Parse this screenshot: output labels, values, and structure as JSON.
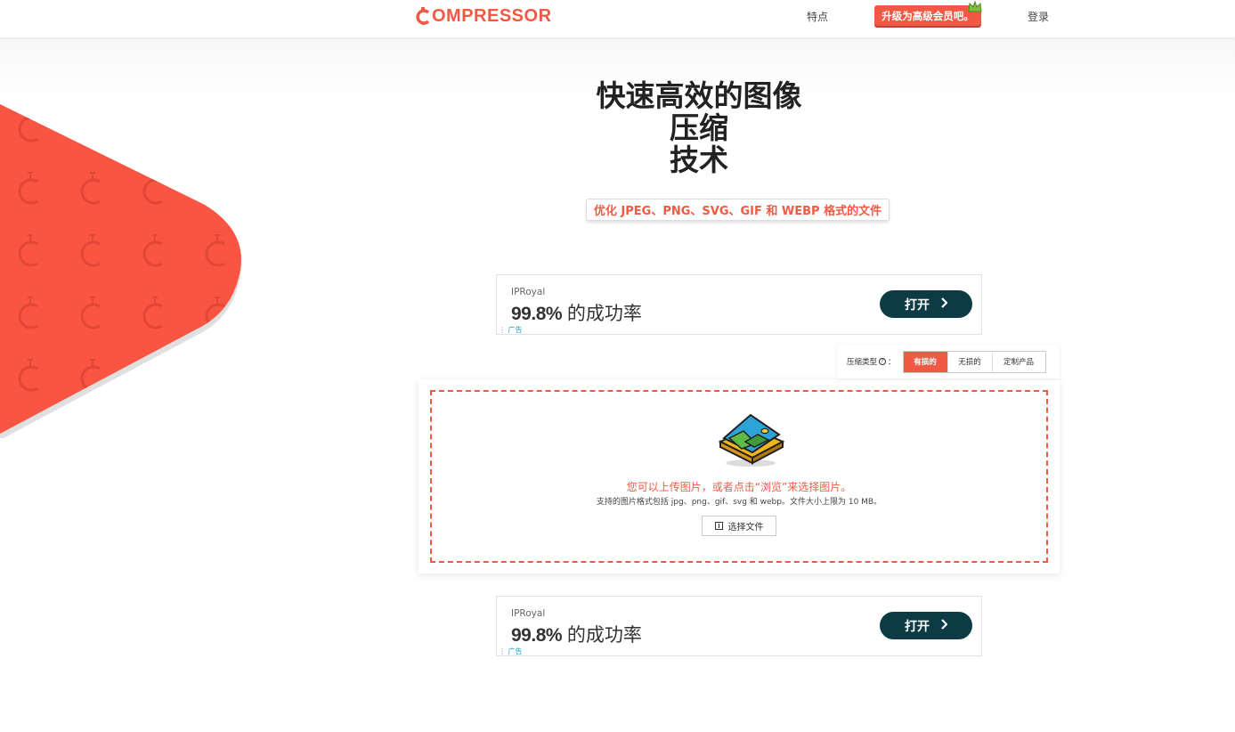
{
  "header": {
    "logo_text": "OMPRESSOR",
    "logo_initial": "C",
    "nav_features": "特点",
    "upgrade_label": "升级为高级会员吧。",
    "nav_login": "登录"
  },
  "hero": {
    "title_lines": [
      "快速高效的图像",
      "压缩",
      "技术"
    ],
    "formats": "优化 JPEG、PNG、SVG、GIF 和 WEBP 格式的文件"
  },
  "ads": [
    {
      "brand": "IPRoyal",
      "headline_number": "99.8%",
      "headline_text": " 的成功率",
      "tag": "广告",
      "button": "打开"
    },
    {
      "brand": "IPRoyal",
      "headline_number": "99.8%",
      "headline_text": " 的成功率",
      "tag": "广告",
      "button": "打开"
    }
  ],
  "compression": {
    "label": "压缩类型",
    "label_suffix": "：",
    "tabs": [
      "有损的",
      "无损的",
      "定制产品"
    ],
    "active_index": 0
  },
  "dropzone": {
    "main_text": "您可以上传图片，或者点击“浏览”来选择图片。",
    "sub_text": "支持的图片格式包括 jpg、png、gif、svg 和 webp。文件大小上限为 10 MB。",
    "choose_label": "选择文件"
  },
  "colors": {
    "brand": "#f05a45",
    "ad_button": "#0d3b45"
  },
  "icons": {
    "logo": "logo-icon",
    "crown": "crown-icon",
    "image": "image-upload-icon",
    "chevron": "chevron-right-icon",
    "help": "help-icon",
    "file": "file-icon"
  }
}
